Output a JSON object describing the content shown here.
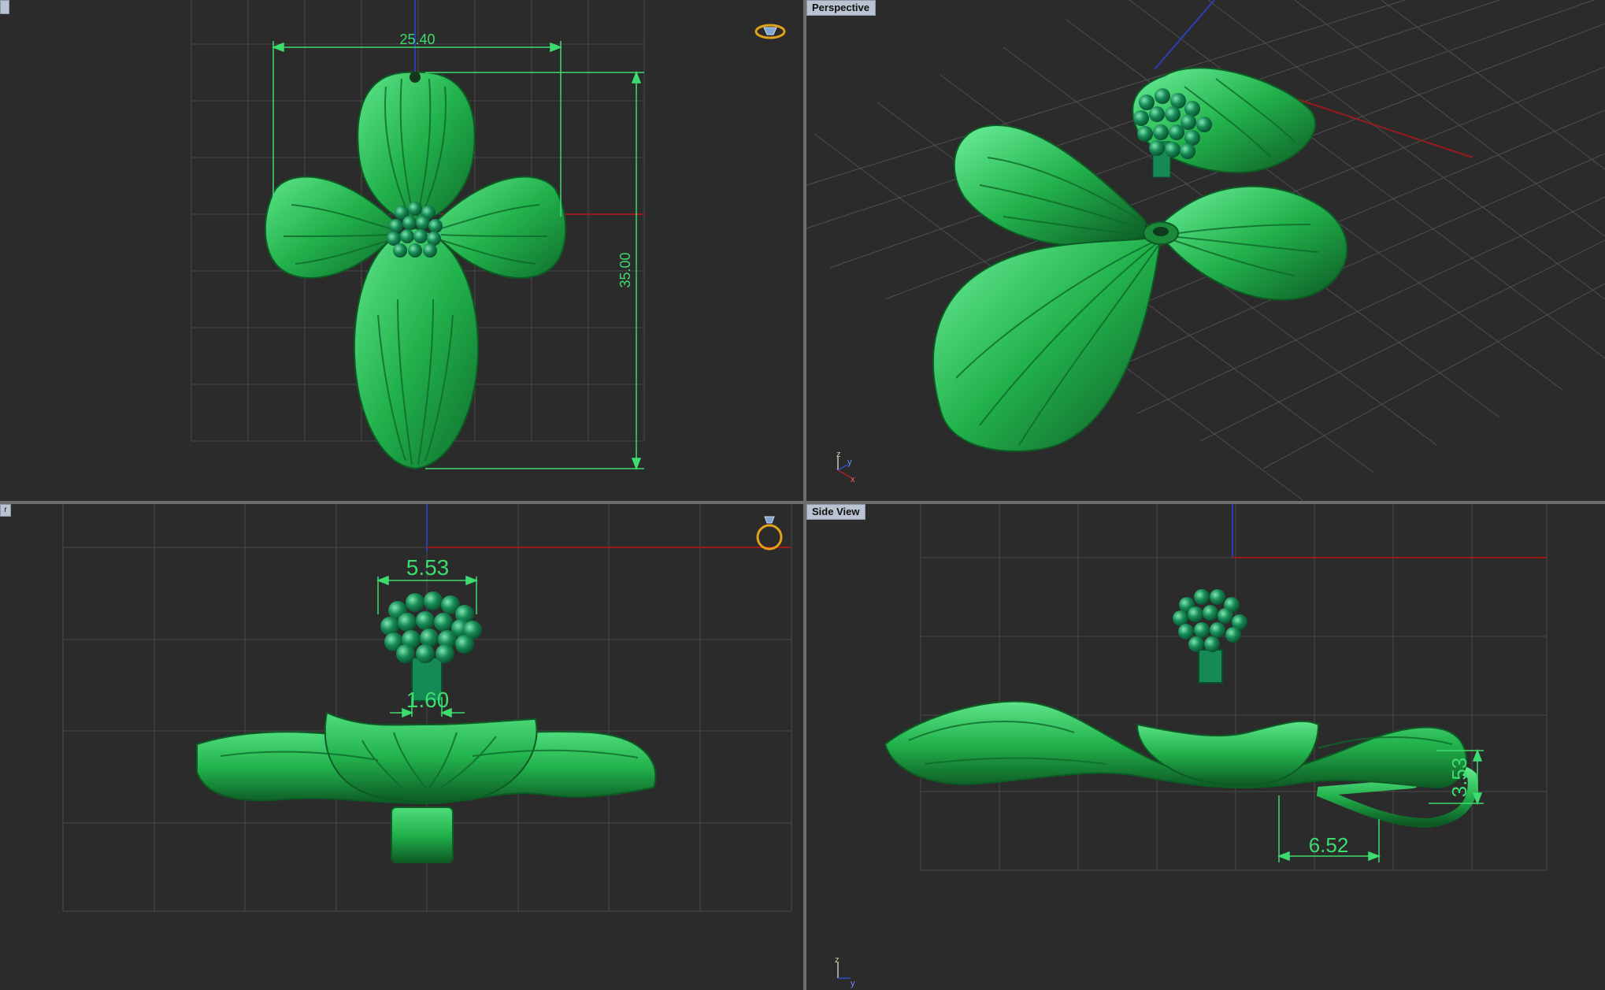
{
  "viewports": {
    "top": {
      "label": ""
    },
    "perspective": {
      "label": "Perspective"
    },
    "front": {
      "label": "r"
    },
    "side": {
      "label": "Side View"
    }
  },
  "dimensions": {
    "top_width": "25.40",
    "top_height": "35.00",
    "front_stamen_width": "5.53",
    "front_stem_width": "1.60",
    "side_loop_height": "3.53",
    "side_loop_width": "6.52"
  },
  "axes": {
    "z": "z",
    "y": "y",
    "x": "x"
  },
  "colors": {
    "background": "#2b2b2b",
    "grid": "#5a5a5a",
    "model": "#22b24c",
    "dimension": "#3ddc6e",
    "x_axis": "#9a1a1a",
    "y_axis": "#2a3fb5"
  },
  "icons": [
    "gem-icon",
    "ring-icon"
  ]
}
